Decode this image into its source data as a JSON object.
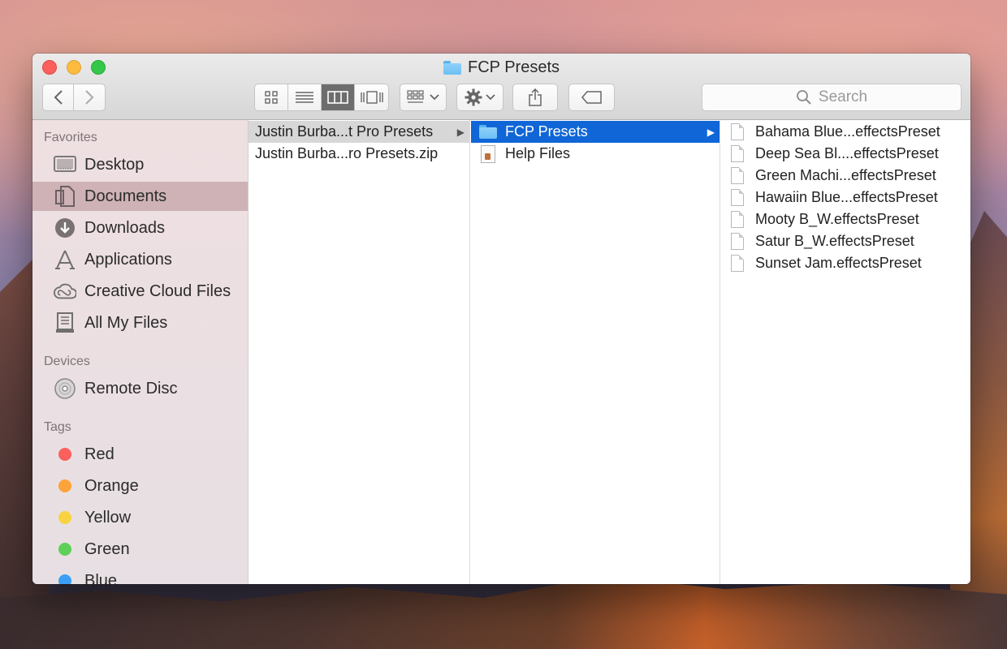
{
  "window": {
    "title": "FCP Presets"
  },
  "toolbar": {
    "back_label": "‹",
    "forward_label": "›",
    "search_placeholder": "Search"
  },
  "sidebar": {
    "favorites_header": "Favorites",
    "favorites": [
      {
        "label": "Desktop",
        "icon": "desktop-icon"
      },
      {
        "label": "Documents",
        "icon": "documents-icon",
        "selected": true
      },
      {
        "label": "Downloads",
        "icon": "downloads-icon"
      },
      {
        "label": "Applications",
        "icon": "applications-icon"
      },
      {
        "label": "Creative Cloud Files",
        "icon": "creative-cloud-icon"
      },
      {
        "label": "All My Files",
        "icon": "all-files-icon"
      }
    ],
    "devices_header": "Devices",
    "devices": [
      {
        "label": "Remote Disc",
        "icon": "disc-icon"
      }
    ],
    "tags_header": "Tags",
    "tags": [
      {
        "label": "Red",
        "color": "#fc605c"
      },
      {
        "label": "Orange",
        "color": "#fda33a"
      },
      {
        "label": "Yellow",
        "color": "#f9d33f"
      },
      {
        "label": "Green",
        "color": "#5fd057"
      },
      {
        "label": "Blue",
        "color": "#3b9ff6"
      }
    ]
  },
  "columns": {
    "col1": [
      {
        "label": "Justin Burba...t Pro Presets",
        "type": "folder",
        "selected": "inactive"
      },
      {
        "label": "Justin Burba...ro Presets.zip",
        "type": "file"
      }
    ],
    "col2": [
      {
        "label": "FCP Presets",
        "type": "folder",
        "selected": "active"
      },
      {
        "label": "Help Files",
        "type": "file"
      }
    ],
    "col3": [
      {
        "label": "Bahama Blue...effectsPreset"
      },
      {
        "label": "Deep Sea Bl....effectsPreset"
      },
      {
        "label": "Green Machi...effectsPreset"
      },
      {
        "label": "Hawaiin Blue...effectsPreset"
      },
      {
        "label": "Mooty B_W.effectsPreset"
      },
      {
        "label": "Satur B_W.effectsPreset"
      },
      {
        "label": "Sunset Jam.effectsPreset"
      }
    ]
  },
  "colors": {
    "selection_blue": "#1066d6",
    "selection_gray": "#d7d7d7"
  }
}
